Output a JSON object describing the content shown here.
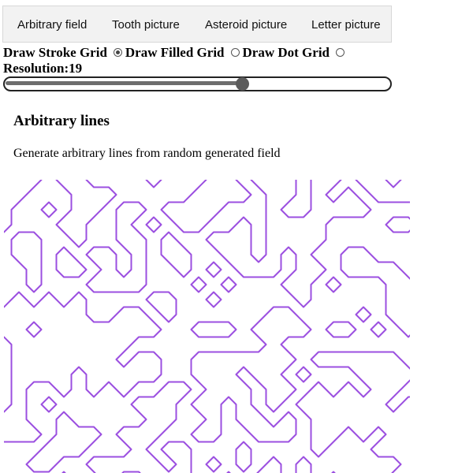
{
  "tabs": [
    {
      "label": "Arbitrary field"
    },
    {
      "label": "Tooth picture"
    },
    {
      "label": "Asteroid picture"
    },
    {
      "label": "Letter picture"
    }
  ],
  "grid_options": [
    {
      "label": "Draw Stroke Grid",
      "checked": true
    },
    {
      "label": "Draw Filled Grid",
      "checked": false
    },
    {
      "label": "Draw Dot Grid",
      "checked": false
    }
  ],
  "resolution": {
    "label": "Resolution:",
    "value": "19",
    "fraction": 0.62
  },
  "section": {
    "title": "Arbitrary lines",
    "description": "Generate arbitrary lines from random generated field"
  },
  "colors": {
    "line": "#9b4fe0"
  }
}
